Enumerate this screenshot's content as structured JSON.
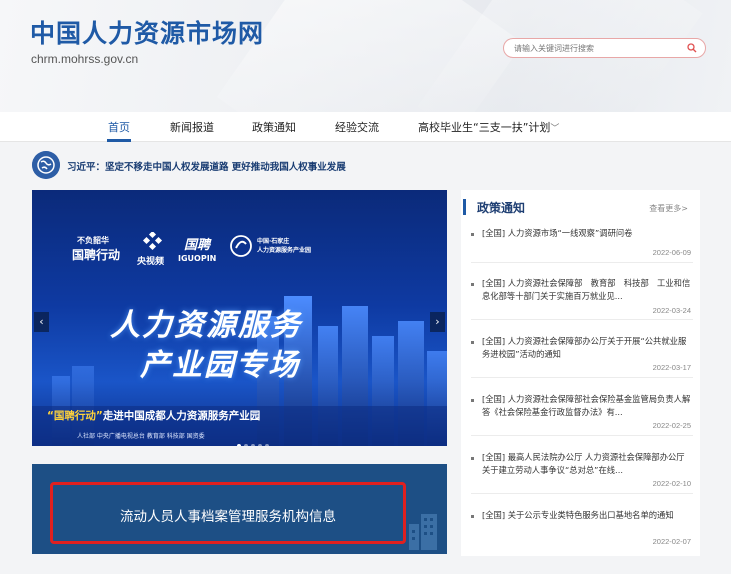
{
  "header": {
    "site_title": "中国人力资源市场网",
    "domain": "chrm.mohrss.gov.cn",
    "search_placeholder": "请输入关键词进行搜索"
  },
  "nav": {
    "items": [
      "首页",
      "新闻报道",
      "政策通知",
      "经验交流",
      "高校毕业生“三支一扶”计划"
    ],
    "active": "首页"
  },
  "headline": "习近平：坚定不移走中国人权发展道路 更好推动我国人权事业发展",
  "banner": {
    "logo1": "不负韶华",
    "logo1b": "国聘行动",
    "logo2": "央视频",
    "logo3": "国聘",
    "logo3b": "IGUOPIN",
    "logo4": "中国·石家庄",
    "logo4b": "人力资源服务产业园",
    "title1": "人力资源服务",
    "title2": "产业园专场",
    "caption_highlight": "“国聘行动”",
    "caption_rest": "走进中国成都人力资源服务产业园",
    "footer": "人社部  中央广播电视总台  教育部  科技部  国资委",
    "slides": 5,
    "active_slide": 0
  },
  "card": {
    "label": "流动人员人事档案管理服务机构信息"
  },
  "panel": {
    "title": "政策通知",
    "more": "查看更多>",
    "items": [
      {
        "text": "[全国] 人力资源市场“一线观察”调研问卷",
        "date": "2022-06-09"
      },
      {
        "text": "[全国] 人力资源社会保障部　教育部　科技部　工业和信息化部等十部门关于实施百万就业见...",
        "date": "2022-03-24"
      },
      {
        "text": "[全国] 人力资源社会保障部办公厅关于开展“公共就业服务进校园”活动的通知",
        "date": "2022-03-17"
      },
      {
        "text": "[全国] 人力资源社会保障部社会保险基金监管局负责人解答《社会保险基金行政监督办法》有...",
        "date": "2022-02-25"
      },
      {
        "text": "[全国] 最高人民法院办公厅 人力资源社会保障部办公厅关于建立劳动人事争议“总对总”在线...",
        "date": "2022-02-10"
      },
      {
        "text": "[全国] 关于公示专业类特色服务出口基地名单的通知",
        "date": "2022-02-07"
      }
    ]
  },
  "colors": {
    "brand_blue": "#1f5aa6",
    "card_blue": "#1d4f85",
    "highlight_red": "#e02020",
    "banner_yellow": "#ffd23a"
  }
}
